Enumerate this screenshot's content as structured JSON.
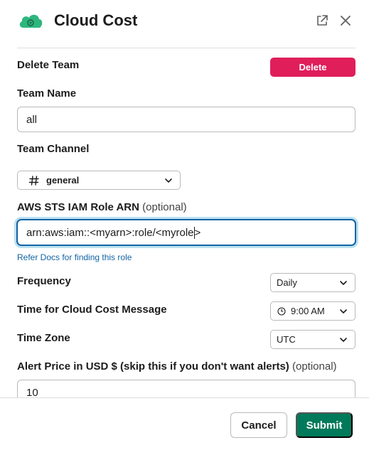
{
  "header": {
    "title": "Cloud Cost",
    "app_icon": "cloud-icon",
    "external_icon": "open-in-new-window-icon",
    "close_icon": "close-icon"
  },
  "delete_team": {
    "label": "Delete Team",
    "button_label": "Delete"
  },
  "team_name": {
    "label": "Team Name",
    "value": "all"
  },
  "team_channel": {
    "label": "Team Channel",
    "icon": "hash-icon",
    "value": "general"
  },
  "role_arn": {
    "label": "AWS STS IAM Role ARN",
    "optional": "(optional)",
    "value_before_caret": "arn:aws:iam::<myarn>:role/<myrole",
    "value_after_caret": ">",
    "docs_link": "Refer Docs for finding this role"
  },
  "frequency": {
    "label": "Frequency",
    "value": "Daily"
  },
  "time": {
    "label": "Time for Cloud Cost Message",
    "icon": "clock-icon",
    "value": "9:00 AM"
  },
  "timezone": {
    "label": "Time Zone",
    "value": "UTC"
  },
  "alert_price": {
    "label": "Alert Price in USD $ (skip this if you don't want alerts)",
    "optional": "(optional)",
    "value": "10"
  },
  "footer": {
    "cancel_label": "Cancel",
    "submit_label": "Submit"
  },
  "colors": {
    "accent": "#1264a3",
    "danger": "#e01e5a",
    "primary": "#007a5a",
    "brand_cloud": "#2eb67d"
  }
}
